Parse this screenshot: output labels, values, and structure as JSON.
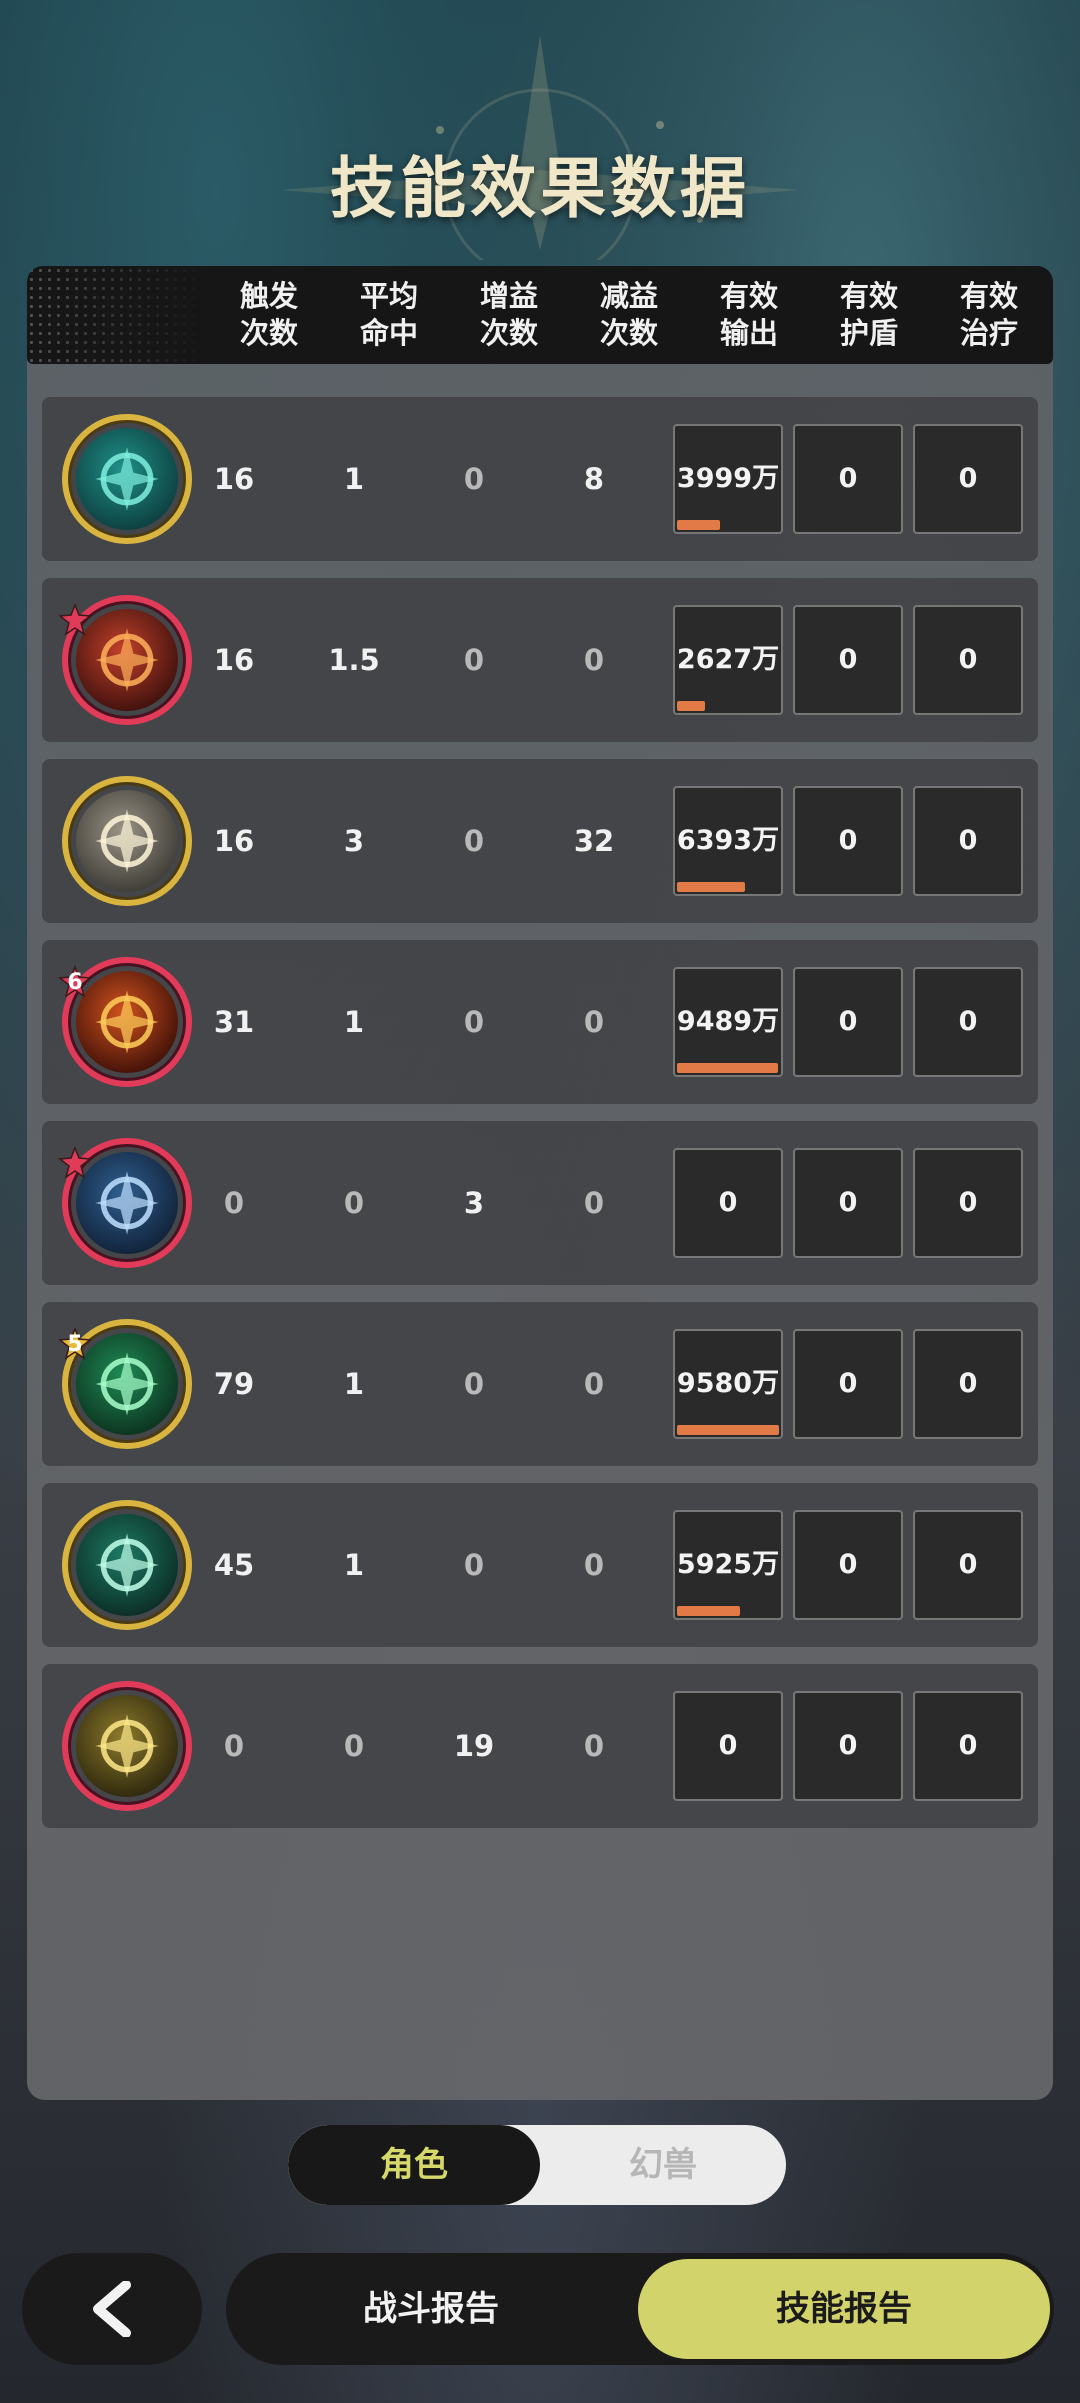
{
  "title": "技能效果数据",
  "columns": [
    {
      "line1": "触发",
      "line2": "次数"
    },
    {
      "line1": "平均",
      "line2": "命中"
    },
    {
      "line1": "增益",
      "line2": "次数"
    },
    {
      "line1": "减益",
      "line2": "次数"
    },
    {
      "line1": "有效",
      "line2": "输出"
    },
    {
      "line1": "有效",
      "line2": "护盾"
    },
    {
      "line1": "有效",
      "line2": "治疗"
    }
  ],
  "rows": [
    {
      "icon": "teal-vortex-skill-icon",
      "frame": "gold",
      "badge": "",
      "trigger": "16",
      "avg_hit": "1",
      "buff": "0",
      "debuff": "8",
      "output": "3999万",
      "output_fraction": 0.42,
      "shield": "0",
      "heal": "0"
    },
    {
      "icon": "fire-slash-skill-icon",
      "frame": "red",
      "badge": "star",
      "trigger": "16",
      "avg_hit": "1.5",
      "buff": "0",
      "debuff": "0",
      "output": "2627万",
      "output_fraction": 0.27,
      "shield": "0",
      "heal": "0"
    },
    {
      "icon": "lightning-star-skill-icon",
      "frame": "gold",
      "badge": "",
      "trigger": "16",
      "avg_hit": "3",
      "buff": "0",
      "debuff": "32",
      "output": "6393万",
      "output_fraction": 0.67,
      "shield": "0",
      "heal": "0"
    },
    {
      "icon": "fire-swirl-skill-icon",
      "frame": "red",
      "badge": "6",
      "trigger": "31",
      "avg_hit": "1",
      "buff": "0",
      "debuff": "0",
      "output": "9489万",
      "output_fraction": 0.99,
      "shield": "0",
      "heal": "0"
    },
    {
      "icon": "crown-shield-skill-icon",
      "frame": "red",
      "badge": "star",
      "trigger": "0",
      "avg_hit": "0",
      "buff": "3",
      "debuff": "0",
      "output": "0",
      "output_fraction": 0,
      "shield": "0",
      "heal": "0"
    },
    {
      "icon": "green-leaf-skill-icon",
      "frame": "gold",
      "badge": "5",
      "trigger": "79",
      "avg_hit": "1",
      "buff": "0",
      "debuff": "0",
      "output": "9580万",
      "output_fraction": 1.0,
      "shield": "0",
      "heal": "0"
    },
    {
      "icon": "green-arrows-skill-icon",
      "frame": "gold",
      "badge": "",
      "trigger": "45",
      "avg_hit": "1",
      "buff": "0",
      "debuff": "0",
      "output": "5925万",
      "output_fraction": 0.62,
      "shield": "0",
      "heal": "0"
    },
    {
      "icon": "golden-spirit-skill-icon",
      "frame": "red",
      "badge": "",
      "trigger": "0",
      "avg_hit": "0",
      "buff": "19",
      "debuff": "0",
      "output": "0",
      "output_fraction": 0,
      "shield": "0",
      "heal": "0"
    }
  ],
  "toggle": {
    "active": "角色",
    "inactive": "幻兽"
  },
  "bottom": {
    "back_icon": "chevron-left-icon",
    "tab_battle": "战斗报告",
    "tab_skill": "技能报告"
  }
}
